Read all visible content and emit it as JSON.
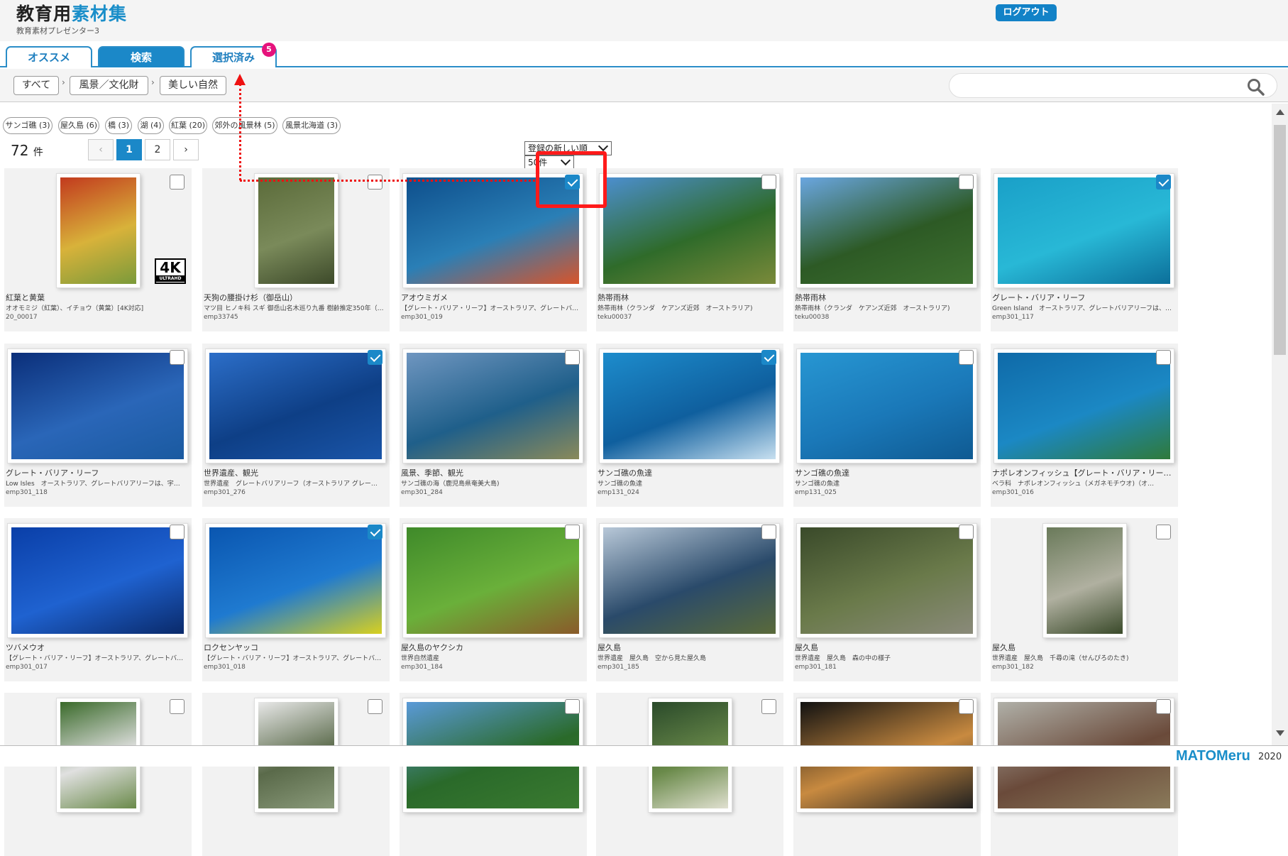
{
  "header": {
    "brand_main": "教育用",
    "brand_accent": "素材集",
    "brand_sub": "教育素材プレゼンター3",
    "logout_label": "ログアウト"
  },
  "tabs": [
    {
      "label": "オススメ",
      "active": false
    },
    {
      "label": "検索",
      "active": true
    },
    {
      "label": "選択済み",
      "active": false,
      "badge": "5"
    }
  ],
  "breadcrumb": [
    "すべて",
    "風景／文化財",
    "美しい自然"
  ],
  "breadcrumb_sep": "›",
  "search": {
    "value": "",
    "placeholder": ""
  },
  "tags": [
    "サンゴ礁 (3)",
    "屋久島 (6)",
    "橋 (3)",
    "湖 (4)",
    "紅葉 (20)",
    "郊外の風景林 (5)",
    "風景北海道 (3)"
  ],
  "results": {
    "count": "72",
    "unit": "件"
  },
  "pager": {
    "prev": "‹",
    "pages": [
      "1",
      "2"
    ],
    "current": "1",
    "next": "›"
  },
  "sort": {
    "selected": "登録の新しい順",
    "per_page": "50件"
  },
  "items": [
    {
      "title": "紅葉と黄葉",
      "desc": "オオモミジ（紅葉）、イチョウ（黄葉）[4K対応]",
      "id": "20_00017",
      "checked": false,
      "shape": "tall",
      "colors": [
        "#c23a1e",
        "#d8b23a",
        "#7a9a3a"
      ],
      "badge": "4K",
      "badge_sub": "ULTRAHD"
    },
    {
      "title": "天狗の腰掛け杉（御岳山）",
      "desc": "マツ目 ヒノキ科 スギ 御岳山名木巡り九番 樹齢推定350年（…",
      "id": "emp33745",
      "checked": false,
      "shape": "tall",
      "colors": [
        "#5b6b3a",
        "#7a8a5a",
        "#3d4a2a"
      ]
    },
    {
      "title": "アオウミガメ",
      "desc": "【グレート・バリア・リーフ】オーストラリア、グレートバ…",
      "id": "emp301_019",
      "checked": true,
      "shape": "wide",
      "colors": [
        "#0e4f8c",
        "#2a7fb6",
        "#d8542a"
      ]
    },
    {
      "title": "熱帯雨林",
      "desc": "熱帯雨林（クランダ　ケアンズ近郊　オーストラリア)",
      "id": "teku00037",
      "checked": false,
      "shape": "wide",
      "colors": [
        "#4c8fd0",
        "#2f6b2a",
        "#7a8a3a"
      ]
    },
    {
      "title": "熱帯雨林",
      "desc": "熱帯雨林（クランダ　ケアンズ近郊　オーストラリア)",
      "id": "teku00038",
      "checked": false,
      "shape": "wide",
      "colors": [
        "#6aa6e0",
        "#2d5a25",
        "#3e7030"
      ]
    },
    {
      "title": "グレート・バリア・リーフ",
      "desc": "Green Island　オーストラリア、グレートバリアリーフは、…",
      "id": "emp301_117",
      "checked": true,
      "shape": "wide",
      "colors": [
        "#1aa0c8",
        "#28b8d6",
        "#0c6f9a"
      ]
    },
    {
      "title": "グレート・バリア・リーフ",
      "desc": "Low Isles　オーストラリア、グレートバリアリーフは、宇…",
      "id": "emp301_118",
      "checked": false,
      "shape": "wide",
      "colors": [
        "#0b2f7a",
        "#2a66b8",
        "#1a5aa0"
      ]
    },
    {
      "title": "世界遺産、観光",
      "desc": "世界遺産　グレートバリアリーフ（オーストラリア グレー…",
      "id": "emp301_276",
      "checked": true,
      "shape": "wide",
      "colors": [
        "#2c6ec8",
        "#0e3f86",
        "#1a55a8"
      ]
    },
    {
      "title": "風景、季節、観光",
      "desc": "サンゴ礁の海（鹿児島県奄美大島)",
      "id": "emp301_284",
      "checked": false,
      "shape": "wide",
      "colors": [
        "#6f96c0",
        "#1f5f8a",
        "#8a8a5a"
      ]
    },
    {
      "title": "サンゴ礁の魚達",
      "desc": "サンゴ礁の魚達",
      "id": "emp131_024",
      "checked": true,
      "shape": "wide",
      "colors": [
        "#1d8ccc",
        "#0f5f9e",
        "#c8e0f0"
      ]
    },
    {
      "title": "サンゴ礁の魚達",
      "desc": "サンゴ礁の魚達",
      "id": "emp131_025",
      "checked": false,
      "shape": "wide",
      "colors": [
        "#2796d2",
        "#1a78b8",
        "#0f5a92"
      ]
    },
    {
      "title": "ナポレオンフィッシュ【グレート・バリア・リー…",
      "desc": "ベラ科　ナポレオンフィッシュ（メガネモチウオ)（オ…",
      "id": "emp301_016",
      "checked": false,
      "shape": "wide",
      "colors": [
        "#0f6aa8",
        "#1b88c4",
        "#2f7a3a"
      ]
    },
    {
      "title": "ツバメウオ",
      "desc": "【グレート・バリア・リーフ】オーストラリア、グレートバ…",
      "id": "emp301_017",
      "checked": false,
      "shape": "wide",
      "colors": [
        "#0a3fa8",
        "#1f62d0",
        "#0a2a6a"
      ]
    },
    {
      "title": "ロクセンヤッコ",
      "desc": "【グレート・バリア・リーフ】オーストラリア、グレートバ…",
      "id": "emp301_018",
      "checked": true,
      "shape": "wide",
      "colors": [
        "#0a56b0",
        "#1f7ad0",
        "#d8d020"
      ]
    },
    {
      "title": "屋久島のヤクシカ",
      "desc": "世界自然遺産",
      "id": "emp301_184",
      "checked": false,
      "shape": "wide",
      "colors": [
        "#3f8a2a",
        "#6ab03a",
        "#8a5a2a"
      ]
    },
    {
      "title": "屋久島",
      "desc": "世界遺産　屋久島　空から見た屋久島",
      "id": "emp301_185",
      "checked": false,
      "shape": "wide",
      "colors": [
        "#b8c8d8",
        "#2a4a6a",
        "#5a6a3a"
      ]
    },
    {
      "title": "屋久島",
      "desc": "世界遺産　屋久島　森の中の様子",
      "id": "emp301_181",
      "checked": false,
      "shape": "wide",
      "colors": [
        "#3a4a2a",
        "#6a7a4a",
        "#8a8a7a"
      ]
    },
    {
      "title": "屋久島",
      "desc": "世界遺産　屋久島　千尋の滝（せんぴろのたき)",
      "id": "emp301_182",
      "checked": false,
      "shape": "tall",
      "colors": [
        "#6a7a5a",
        "#b0b0a0",
        "#3a4a2a"
      ]
    },
    {
      "title": "",
      "desc": "",
      "id": "",
      "checked": false,
      "shape": "tall",
      "colors": [
        "#3a6a2a",
        "#e0e0e0",
        "#6a8a4a"
      ]
    },
    {
      "title": "",
      "desc": "",
      "id": "",
      "checked": false,
      "shape": "tall",
      "colors": [
        "#e8e8e8",
        "#5a6a4a",
        "#8a9a7a"
      ]
    },
    {
      "title": "",
      "desc": "",
      "id": "",
      "checked": false,
      "shape": "wide",
      "colors": [
        "#5a9ad8",
        "#2a6a2a",
        "#3a7a30"
      ]
    },
    {
      "title": "",
      "desc": "",
      "id": "",
      "checked": false,
      "shape": "tall",
      "colors": [
        "#2a4a2a",
        "#6a8a4a",
        "#e0e0d0"
      ]
    },
    {
      "title": "",
      "desc": "",
      "id": "",
      "checked": false,
      "shape": "wide",
      "colors": [
        "#111111",
        "#c88a40",
        "#202020"
      ]
    },
    {
      "title": "",
      "desc": "",
      "id": "",
      "checked": false,
      "shape": "wide",
      "colors": [
        "#b0b0a8",
        "#6a4a3a",
        "#8a7a5a"
      ]
    }
  ],
  "footer": {
    "logo": "MATOMeru",
    "year": "2020"
  },
  "colors": {
    "accent": "#1b88c8",
    "badge": "#e6127c",
    "annotation": "#ff1a1a"
  }
}
